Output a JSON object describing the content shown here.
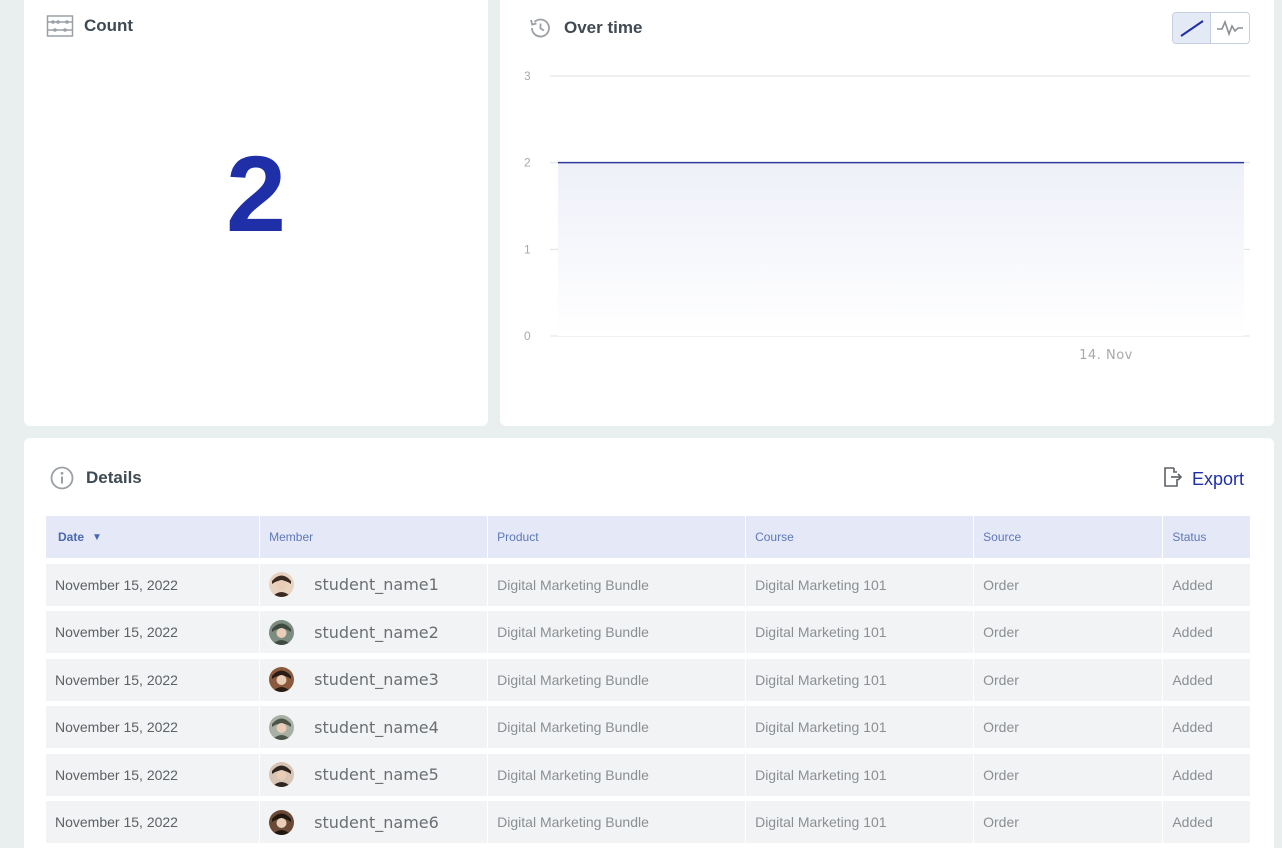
{
  "count_card": {
    "title": "Count",
    "icon": "abacus-icon",
    "value": "2"
  },
  "time_card": {
    "title": "Over time",
    "icon": "history-icon",
    "toggles": [
      {
        "name": "line-chart-toggle",
        "active": true
      },
      {
        "name": "spiky-chart-toggle",
        "active": false
      }
    ]
  },
  "chart_data": {
    "type": "area",
    "x": [
      "14. Nov"
    ],
    "series": [
      {
        "values": [
          2,
          2
        ]
      }
    ],
    "y_ticks": [
      "0",
      "1",
      "2",
      "3"
    ],
    "x_ticks": [
      "14. Nov"
    ],
    "ylim": [
      0,
      3
    ],
    "grid": true,
    "color": "#2c3a9a"
  },
  "details_card": {
    "title": "Details",
    "icon": "info-circle-icon",
    "export_label": "Export",
    "table": {
      "headers": [
        "Date",
        "Member",
        "Product",
        "Course",
        "Source",
        "Status"
      ],
      "sort_indicator": "▼",
      "rows": [
        {
          "date": "November 15, 2022",
          "member": "student_name1",
          "product": "Digital Marketing Bundle",
          "course": "Digital Marketing 101",
          "source": "Order",
          "status": "Added"
        },
        {
          "date": "November 15, 2022",
          "member": "student_name2",
          "product": "Digital Marketing Bundle",
          "course": "Digital Marketing 101",
          "source": "Order",
          "status": "Added"
        },
        {
          "date": "November 15, 2022",
          "member": "student_name3",
          "product": "Digital Marketing Bundle",
          "course": "Digital Marketing 101",
          "source": "Order",
          "status": "Added"
        },
        {
          "date": "November 15, 2022",
          "member": "student_name4",
          "product": "Digital Marketing Bundle",
          "course": "Digital Marketing 101",
          "source": "Order",
          "status": "Added"
        },
        {
          "date": "November 15, 2022",
          "member": "student_name5",
          "product": "Digital Marketing Bundle",
          "course": "Digital Marketing 101",
          "source": "Order",
          "status": "Added"
        },
        {
          "date": "November 15, 2022",
          "member": "student_name6",
          "product": "Digital Marketing Bundle",
          "course": "Digital Marketing 101",
          "source": "Order",
          "status": "Added"
        }
      ]
    }
  },
  "colors": {
    "accent": "#1e2fa8",
    "header_bg": "#e4e8f7",
    "row_bg": "#f2f3f4",
    "page_bg": "#e9eeee"
  }
}
